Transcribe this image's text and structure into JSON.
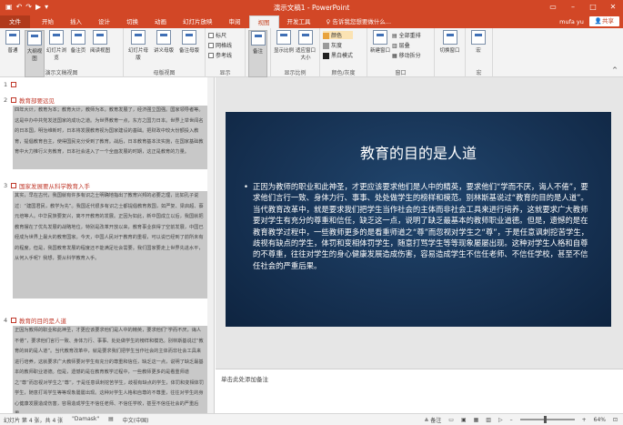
{
  "window": {
    "title": "演示文稿1 - PowerPoint",
    "qat_icons": [
      "save-icon",
      "undo-icon",
      "redo-icon",
      "start-from-beginning-icon",
      "customize-icon"
    ],
    "controls": [
      "minimize",
      "maximize",
      "close"
    ]
  },
  "tabs": {
    "file": "文件",
    "items": [
      "开始",
      "插入",
      "设计",
      "切换",
      "动画",
      "幻灯片放映",
      "审阅",
      "视图",
      "开发工具"
    ],
    "active": "视图",
    "tell_me": "告诉我您想要做什么...",
    "user": "mufa yu",
    "share": "共享"
  },
  "ribbon": {
    "groups": [
      {
        "label": "演示文稿视图",
        "buttons": [
          "普通",
          "大纲视图",
          "幻灯片浏览",
          "备注页",
          "阅读视图"
        ],
        "selected": "大纲视图"
      },
      {
        "label": "母版视图",
        "buttons": [
          "幻灯片母版",
          "讲义母版",
          "备注母版"
        ]
      },
      {
        "label": "显示",
        "checkboxes": [
          "标尺",
          "网格线",
          "参考线"
        ]
      },
      {
        "label": "",
        "buttons": [
          "备注"
        ]
      },
      {
        "label": "显示比例",
        "buttons": [
          "显示比例",
          "适应窗口大小"
        ]
      },
      {
        "label": "颜色/灰度",
        "options": [
          "颜色",
          "灰度",
          "黑白模式"
        ]
      },
      {
        "label": "窗口",
        "buttons": [
          "新建窗口"
        ],
        "options": [
          "全部重排",
          "层叠",
          "移动拆分"
        ]
      },
      {
        "label": "",
        "buttons": [
          "切换窗口"
        ]
      },
      {
        "label": "宏",
        "buttons": [
          "宏"
        ]
      }
    ],
    "colors": {
      "color_swatch": "#e8a33d",
      "gray_swatch": "#9a9a9a",
      "bw_swatch": "#222222"
    }
  },
  "outline": {
    "sections": [
      {
        "num": "1",
        "title": ""
      },
      {
        "num": "2",
        "title": "教育部要远见",
        "body": "四年大计，教育为本；教育大计，教师为本。教育发展了，经济强立国强。国家领导者等。这是中办中共党发送国家的成功之道。为世界教育一点，东方之国力日本。世界上举世闻名的日本国，明治维新时，日本将发展教育视为国家建设的基础。把财政中较大份额投入教育，提倡教育自主，使得国民充分受到了教育。战后，日本教育基本法实施，在国家基础教育中大力推行义务教育，日本社会进入了一个全面发展的时期，这正是教育的力量。"
      },
      {
        "num": "3",
        "title": "国家发展要从科学教育入手",
        "body": "其实，早在古代，我国就有许多有识之士明确地指出了教育兴邦的必要之理，比如孔子说过：“建国君民，教学为先”。我国近代很多有识之士都提倡教育救国，如严复、梁启超、蔡元培等人。中华民族要复兴，离不开教育的发展。正因为如此，新中国成立以后，我国就把教育摆在了优先发展的战略地位，特别是改革开放以来，教育事业获得了空前发展，中国已经成为世界上最大的教育国家。今天，中国人民对于教育的重视，可以说已经到了前所未有的程度。但是，我国教育发展的程度还不能满足社会需要。我们国家要走上世界先进水平，从何入手呢？我想，要从科学教育入手。"
      },
      {
        "num": "4",
        "title": "教育的目的是人道",
        "body": "正因为教师的职业和此神圣，才更应该要求他们是人中的精英，要求他们“学而不厌，诲人不倦”，要求他们言行一致、身体力行、事事、处处做学生的榜样和模范。别林斯基说过“教育的目的是人道”。当代教育改革中，就是要求我们把学生当作社会的主体而非社会工具来进行培养，这就要求广大教师要对学生有充分的尊重和信任，缺乏这一点，说明了缺乏最基本的教师职业道德。但是，遗憾的是在教育教学过程中，一些教师更多的是看重师道之“尊”而忽视对学生之“尊”，于是任意讽刺挖苦学生，歧视有缺点的学生，体罚和变相体罚学生，随意打骂学生等等现象屡屡出现。这种对学生人格和自尊的不尊重，往往对学生的身心健康发展造成伤害，容易造成学生不信任老师、不信任学校，甚至不信任社会的严重后果。"
      }
    ]
  },
  "slide": {
    "title": "教育的目的是人道",
    "bullet": "•",
    "body": "正因为教师的职业和此神圣，才更应该要求他们是人中的精英，要求他们“学而不厌，诲人不倦”，要求他们言行一致、身体力行、事事、处处做学生的榜样和模范。别林斯基说过“教育的目的是人道”。当代教育改革中，就是要求我们把学生当作社会的主体而非社会工具来进行培养，这就要求广大教师要对学生有充分的尊重和信任，缺乏这一点，说明了缺乏最基本的教师职业道德。但是，遗憾的是在教育教学过程中，一些教师更多的是看重师道之“尊”而忽视对学生之“尊”，于是任意讽刺挖苦学生，歧视有缺点的学生，体罚和变相体罚学生，随意打骂学生等等现象屡屡出现。这种对学生人格和自尊的不尊重，往往对学生的身心健康发展造成伤害，容易造成学生不信任老师、不信任学校，甚至不信任社会的严重后果。"
  },
  "notes": {
    "placeholder": "单击此处添加备注"
  },
  "status": {
    "slide_info": "幻灯片 第 4 张，共 4 张",
    "theme": "\"Damask\"",
    "language": "中文(中国)",
    "notes_label": "备注",
    "zoom": "64%"
  }
}
